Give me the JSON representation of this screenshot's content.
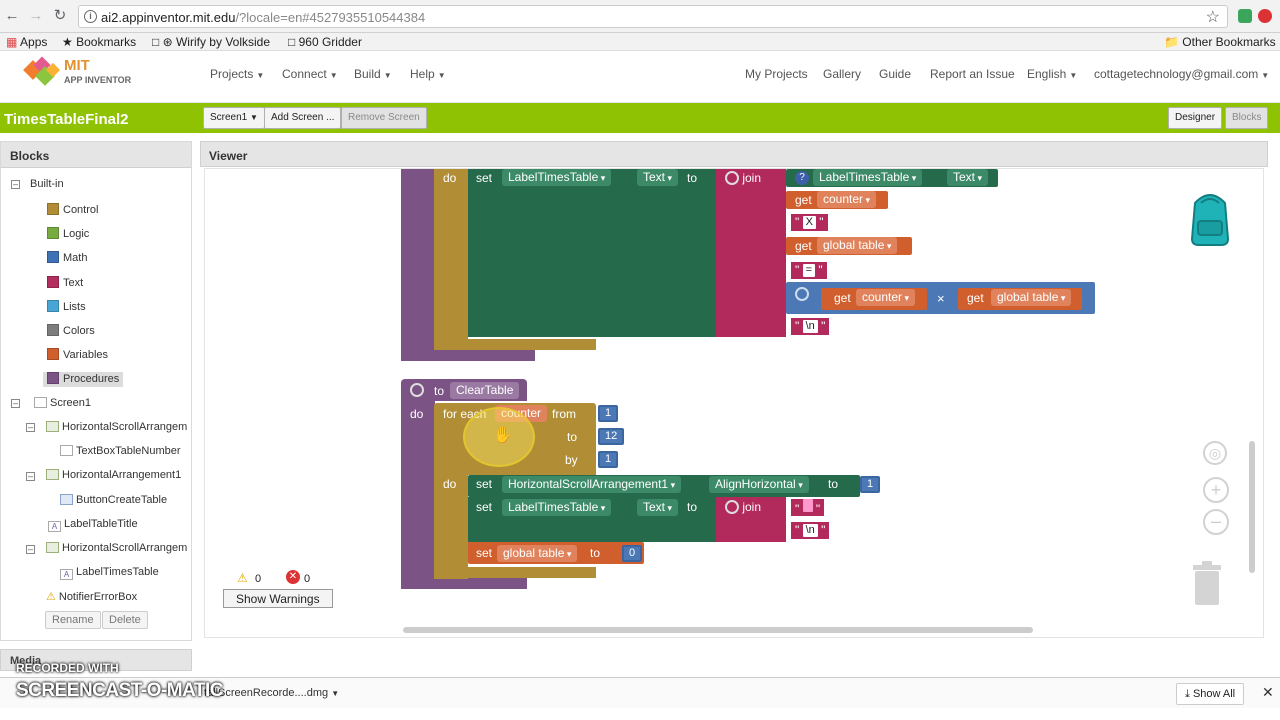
{
  "browser": {
    "url_main": "ai2.appinventor.mit.edu",
    "url_rest": "/?locale=en#4527935510544384",
    "bookmarks": [
      "Apps",
      "Bookmarks",
      "Wirify by Volkside",
      "960 Gridder"
    ],
    "other_bookmarks": "Other Bookmarks"
  },
  "header": {
    "logo_line1": "MIT",
    "logo_line2": "APP INVENTOR",
    "menus": [
      "Projects",
      "Connect",
      "Build",
      "Help"
    ],
    "links": [
      "My Projects",
      "Gallery",
      "Guide",
      "Report an Issue",
      "English",
      "cottagetechnology@gmail.com"
    ]
  },
  "project": {
    "name": "TimesTableFinal2",
    "screen_select": "Screen1",
    "add_screen": "Add Screen ...",
    "remove_screen": "Remove Screen",
    "designer": "Designer",
    "blocks": "Blocks"
  },
  "blocks_panel": {
    "title": "Blocks",
    "builtin": "Built-in",
    "categories": [
      {
        "label": "Control",
        "color": "#b18e35"
      },
      {
        "label": "Logic",
        "color": "#77ab41"
      },
      {
        "label": "Math",
        "color": "#3f71b5"
      },
      {
        "label": "Text",
        "color": "#b32d5e"
      },
      {
        "label": "Lists",
        "color": "#49a6d4"
      },
      {
        "label": "Colors",
        "color": "#7d7d7d"
      },
      {
        "label": "Variables",
        "color": "#d05f2d"
      },
      {
        "label": "Procedures",
        "color": "#7c5385"
      }
    ],
    "components": {
      "screen": "Screen1",
      "h1": "HorizontalScrollArrangem",
      "textbox": "TextBoxTableNumber",
      "h2": "HorizontalArrangement1",
      "button": "ButtonCreateTable",
      "label_title": "LabelTableTitle",
      "h3": "HorizontalScrollArrangem",
      "label_times": "LabelTimesTable",
      "notifier": "NotifierErrorBox"
    },
    "rename": "Rename",
    "delete": "Delete",
    "media": "Media"
  },
  "viewer": {
    "title": "Viewer",
    "warnings_count": "0",
    "errors_count": "0",
    "show_warnings": "Show Warnings"
  },
  "workspace": {
    "top_block": {
      "set_label": "set",
      "component": "LabelTimesTable",
      "prop": "Text",
      "to": "to",
      "join": "join",
      "get_label_component": "LabelTimesTable",
      "get_label_prop": "Text",
      "get1": "get",
      "counter": "counter",
      "x_str": "X",
      "get2": "get",
      "global_table": "global table",
      "eq_str": "=",
      "get3": "get",
      "counter2": "counter",
      "times": "×",
      "get4": "get",
      "global_table2": "global table",
      "nl_str": "\\n",
      "do": "do"
    },
    "proc_block": {
      "to": "to",
      "name": "ClearTable",
      "do": "do",
      "for_each": "for each",
      "var": "counter",
      "from": "from",
      "from_val": "1",
      "to_label": "to",
      "to_val": "12",
      "by": "by",
      "by_val": "1",
      "do2": "do",
      "set1": "set",
      "comp1": "HorizontalScrollArrangement1",
      "prop1": "AlignHorizontal",
      "to1": "to",
      "val1": "1",
      "set2": "set",
      "comp2": "LabelTimesTable",
      "prop2": "Text",
      "to2": "to",
      "join2": "join",
      "str2": "\\n",
      "set3": "set",
      "var3": "global table",
      "to3": "to",
      "val3": "0"
    }
  },
  "downloads": {
    "file": "tallScreenRecorde....dmg",
    "show_all": "Show All"
  },
  "watermark": {
    "line1": "RECORDED WITH",
    "line2": "SCREENCAST-O-MATIC"
  },
  "colors": {
    "green_bar": "#8fc202",
    "procedure": "#7c5385",
    "control": "#b18e35",
    "set_green": "#266a4c",
    "text_block": "#b2295b",
    "math_block": "#4c79b5",
    "variable": "#d05f2d"
  }
}
